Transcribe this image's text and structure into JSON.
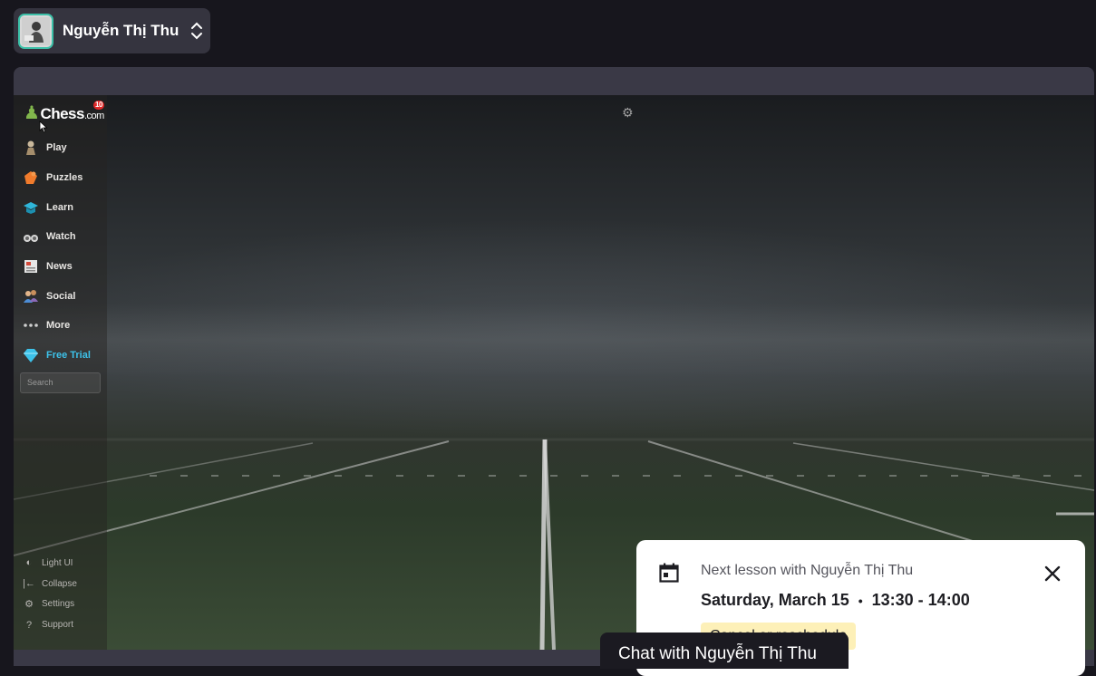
{
  "profile": {
    "name": "Nguyễn Thị Thu"
  },
  "chess_site": {
    "logo_text": "Chess",
    "logo_domain": ".com",
    "logo_badge": "10",
    "nav": [
      {
        "label": "Play",
        "icon": "pawn-hand-icon"
      },
      {
        "label": "Puzzles",
        "icon": "puzzle-icon"
      },
      {
        "label": "Learn",
        "icon": "graduation-cap-icon"
      },
      {
        "label": "Watch",
        "icon": "binoculars-icon"
      },
      {
        "label": "News",
        "icon": "newspaper-icon"
      },
      {
        "label": "Social",
        "icon": "people-icon"
      },
      {
        "label": "More",
        "icon": "ellipsis-icon"
      },
      {
        "label": "Free Trial",
        "icon": "diamond-icon"
      }
    ],
    "search_placeholder": "Search",
    "footer": [
      {
        "label": "Light UI",
        "icon": "half-circle-icon"
      },
      {
        "label": "Collapse",
        "icon": "collapse-arrow-icon"
      },
      {
        "label": "Settings",
        "icon": "gear-icon"
      },
      {
        "label": "Support",
        "icon": "question-icon"
      }
    ]
  },
  "lesson": {
    "label": "Next lesson with Nguyễn Thị Thu",
    "date": "Saturday, March 15",
    "time": "13:30 - 14:00",
    "reschedule_label": "Cancel or reschedule"
  },
  "chat": {
    "label": "Chat with Nguyễn Thị Thu"
  },
  "colors": {
    "accent_teal": "#3cc0a8",
    "trial_blue": "#3dc2ea",
    "highlight_yellow": "#fdf0b8"
  }
}
